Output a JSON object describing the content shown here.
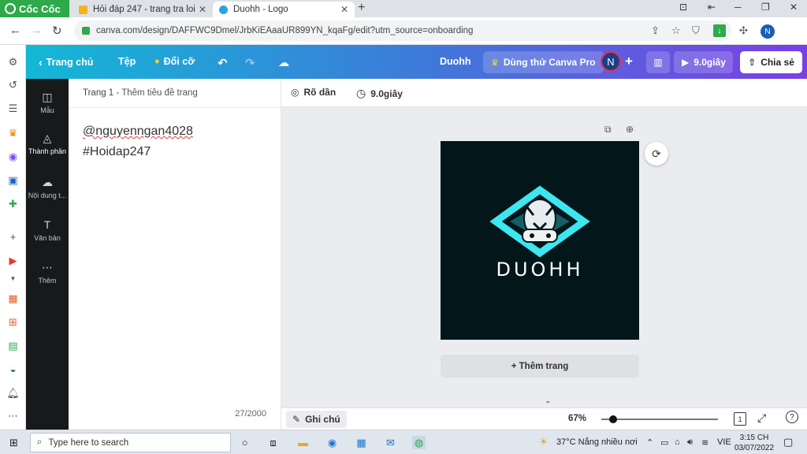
{
  "browser": {
    "brand": "Cốc Cốc",
    "tabs": [
      {
        "title": "Hỏi đáp 247 - trang tra loi",
        "active": false
      },
      {
        "title": "Duohh - Logo",
        "active": true
      }
    ],
    "url": "canva.com/design/DAFFWC9Dmel/JrbKiEAaaUR899YN_kqaFg/edit?utm_source=onboarding",
    "profile_initial": "N"
  },
  "canva_header": {
    "home": "Trang chủ",
    "file": "Tệp",
    "resize": "Đổi cỡ",
    "design_title": "Duohh",
    "try_pro": "Dùng thử Canva Pro",
    "avatar_initial": "N",
    "present": "9.0giây",
    "share": "Chia sẻ"
  },
  "tool_rail": [
    {
      "label": "Mẫu",
      "icon": "template-icon"
    },
    {
      "label": "Thành phần",
      "icon": "elements-icon"
    },
    {
      "label": "Nội dung t...",
      "icon": "upload-icon"
    },
    {
      "label": "Văn bản",
      "icon": "text-icon"
    },
    {
      "label": "Thêm",
      "icon": "more-icon"
    }
  ],
  "notes_panel": {
    "page_label": "Trang 1",
    "page_title_placeholder": " - Thêm tiêu đề trang",
    "lines": [
      "@nguyenngan4028",
      "#Hoidap247"
    ],
    "char_count": "27/2000"
  },
  "canvas_toolbar": {
    "effect": "Rõ dần",
    "duration": "9.0giây"
  },
  "design": {
    "logo_text": "DUOHH",
    "bg_color": "#03171a",
    "accent_color": "#3ee6f0"
  },
  "add_page": "+ Thêm trang",
  "status_bar": {
    "notes": "Ghi chú",
    "zoom": "67%",
    "zoom_fraction": 0.1,
    "page_num": "1"
  },
  "taskbar": {
    "search_placeholder": "Type here to search",
    "weather": "37°C  Nắng nhiều nơi",
    "lang": "VIE",
    "time": "3:15 CH",
    "date": "03/07/2022"
  }
}
